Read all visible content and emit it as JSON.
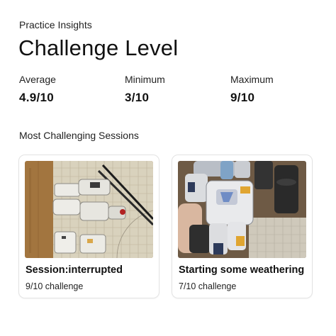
{
  "header": {
    "eyebrow": "Practice Insights",
    "title": "Challenge Level"
  },
  "stats": [
    {
      "label": "Average",
      "value": "4.9/10"
    },
    {
      "label": "Minimum",
      "value": "3/10"
    },
    {
      "label": "Maximum",
      "value": "9/10"
    }
  ],
  "sessions": {
    "section_title": "Most Challenging Sessions",
    "items": [
      {
        "title": "Session:interrupted",
        "subtitle": "9/10 challenge"
      },
      {
        "title": "Starting some weathering",
        "subtitle": "7/10 challenge"
      }
    ]
  }
}
